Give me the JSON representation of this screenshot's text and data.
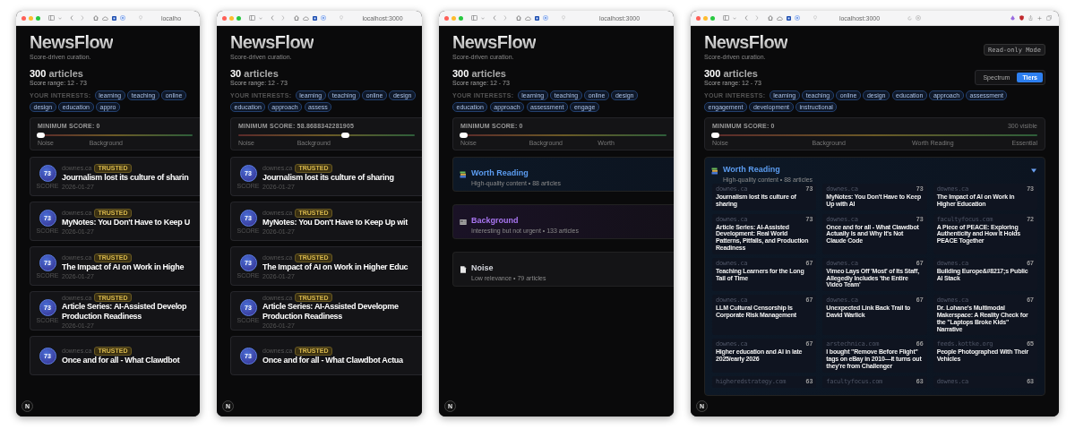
{
  "windows": [
    {
      "url": "localho",
      "toolbar_extras": false,
      "dev_badge": "N",
      "app": {
        "title": "NewsFlow",
        "tagline": "Score-driven curation.",
        "count": "300",
        "count_unit": "articles",
        "score_range": "Score range: 12 - 73",
        "interests_label": "YOUR INTERESTS:",
        "interests": [
          "learning",
          "teaching",
          "online",
          "design",
          "education",
          "appro"
        ],
        "filter": {
          "label": "MINIMUM SCORE: 0",
          "level": 0,
          "scale": [
            "Noise",
            "Background"
          ]
        },
        "view": {
          "kind": "list",
          "cards": [
            {
              "score": "73",
              "score_label": "SCORE",
              "source": "downes.ca",
              "badge": "TRUSTED",
              "title_lines": [
                "Journalism lost its culture of sharin"
              ],
              "date": "2026-01-27"
            },
            {
              "score": "73",
              "score_label": "SCORE",
              "source": "downes.ca",
              "badge": "TRUSTED",
              "title_lines": [
                "MyNotes: You Don't Have to Keep U"
              ],
              "date": "2026-01-27"
            },
            {
              "score": "73",
              "score_label": "SCORE",
              "source": "downes.ca",
              "badge": "TRUSTED",
              "title_lines": [
                "The Impact of AI on Work in Highe"
              ],
              "date": "2026-01-27"
            },
            {
              "score": "73",
              "score_label": "SCORE",
              "source": "downes.ca",
              "badge": "TRUSTED",
              "title_lines": [
                "Article Series: AI-Assisted Develop",
                "Production Readiness"
              ],
              "date": "2026-01-27"
            },
            {
              "score": "73",
              "source": "downes.ca",
              "badge": "TRUSTED",
              "title_lines": [
                "Once and for all - What Clawdbot"
              ]
            }
          ]
        }
      }
    },
    {
      "url": "localhost:3000",
      "toolbar_extras": false,
      "dev_badge": "N",
      "app": {
        "title": "NewsFlow",
        "tagline": "Score-driven curation.",
        "count": "30",
        "count_unit": "articles",
        "score_range": "Score range: 12 - 73",
        "interests_label": "YOUR INTERESTS:",
        "interests": [
          "learning",
          "teaching",
          "online",
          "design",
          "education",
          "approach",
          "assess"
        ],
        "filter": {
          "label": "MINIMUM SCORE: 58.8688342281905",
          "level": 0.59,
          "scale": [
            "Noise",
            "Background"
          ]
        },
        "view": {
          "kind": "list",
          "cards": [
            {
              "score": "73",
              "score_label": "SCORE",
              "source": "downes.ca",
              "badge": "TRUSTED",
              "title_lines": [
                "Journalism lost its culture of sharing"
              ],
              "date": "2026-01-27"
            },
            {
              "score": "73",
              "score_label": "SCORE",
              "source": "downes.ca",
              "badge": "TRUSTED",
              "title_lines": [
                "MyNotes: You Don't Have to Keep Up wit"
              ],
              "date": "2026-01-27"
            },
            {
              "score": "73",
              "score_label": "SCORE",
              "source": "downes.ca",
              "badge": "TRUSTED",
              "title_lines": [
                "The Impact of AI on Work in Higher Educ"
              ],
              "date": "2026-01-27"
            },
            {
              "score": "73",
              "score_label": "SCORE",
              "source": "downes.ca",
              "badge": "TRUSTED",
              "title_lines": [
                "Article Series: AI-Assisted Developme",
                "Production Readiness"
              ],
              "date": "2026-01-27"
            },
            {
              "score": "73",
              "source": "downes.ca",
              "badge": "TRUSTED",
              "title_lines": [
                "Once and for all - What Clawdbot Actua"
              ]
            }
          ]
        }
      }
    },
    {
      "url": "localhost:3000",
      "toolbar_extras": false,
      "dev_badge": "N",
      "app": {
        "title": "NewsFlow",
        "tagline": "Score-driven curation.",
        "count": "300",
        "count_unit": "articles",
        "score_range": "Score range: 12 - 73",
        "interests_label": "YOUR INTERESTS:",
        "interests": [
          "learning",
          "teaching",
          "online",
          "design",
          "education",
          "approach",
          "assessment",
          "engage"
        ],
        "filter": {
          "label": "MINIMUM SCORE: 0",
          "level": 0,
          "scale": [
            "Noise",
            "Background",
            "Worth"
          ]
        },
        "view": {
          "kind": "tiers",
          "tiers": [
            {
              "kind": "worth",
              "name": "Worth Reading",
              "summary": "High-quality content • 88 articles",
              "color": "#5b9cf0",
              "expanded": false
            },
            {
              "kind": "background",
              "name": "Background",
              "summary": "Interesting but not urgent • 133 articles",
              "color": "#a875f0",
              "expanded": false
            },
            {
              "kind": "noise",
              "name": "Noise",
              "summary": "Low relevance • 79 articles",
              "color": "#d4d6dc",
              "expanded": false
            }
          ]
        }
      }
    },
    {
      "url": "localhost:3000",
      "toolbar_extras": true,
      "dev_badge": "N",
      "app": {
        "title": "NewsFlow",
        "tagline": "Score-driven curation.",
        "mode_badge": "Read-only Mode",
        "count": "300",
        "count_unit": "articles",
        "score_range": "Score range: 12 - 73",
        "view_toggle": [
          {
            "label": "Spectrum",
            "selected": false
          },
          {
            "label": "Tiers",
            "selected": true
          }
        ],
        "interests_label": "YOUR INTERESTS:",
        "interests": [
          "learning",
          "teaching",
          "online",
          "design",
          "education",
          "approach",
          "assessment",
          "engagement",
          "development",
          "instructional"
        ],
        "filter": {
          "label": "MINIMUM SCORE: 0",
          "visible": "300 visible",
          "level": 0,
          "scale": [
            "Noise",
            "Background",
            "Worth Reading",
            "Essential"
          ]
        },
        "view": {
          "kind": "tiers",
          "tiers": [
            {
              "kind": "worth",
              "name": "Worth Reading",
              "summary": "High-quality content • 88 articles",
              "color": "#5b9cf0",
              "expanded": true,
              "articles": [
                {
                  "source": "downes.ca",
                  "score": "73",
                  "title": "Journalism lost its culture of sharing"
                },
                {
                  "source": "downes.ca",
                  "score": "73",
                  "title": "MyNotes: You Don't Have to Keep Up with AI"
                },
                {
                  "source": "downes.ca",
                  "score": "73",
                  "title": "The Impact of AI on Work in Higher Education"
                },
                {
                  "source": "downes.ca",
                  "score": "73",
                  "title": "Article Series: AI-Assisted Development: Real World Patterns, Pitfalls, and Production Readiness"
                },
                {
                  "source": "downes.ca",
                  "score": "73",
                  "title": "Once and for all - What Clawdbot Actually Is and Why It's Not Claude Code"
                },
                {
                  "source": "facultyfocus.com",
                  "score": "72",
                  "title": "A Piece of PEACE: Exploring Authenticity and How It Holds PEACE Together"
                },
                {
                  "source": "downes.ca",
                  "score": "67",
                  "title": "Teaching Learners for the Long Tail of Time"
                },
                {
                  "source": "downes.ca",
                  "score": "67",
                  "title": "Vimeo Lays Off 'Most' of Its Staff, Allegedly Includes 'the Entire Video Team'"
                },
                {
                  "source": "downes.ca",
                  "score": "67",
                  "title": "Building Europe&#8217;s Public AI Stack"
                },
                {
                  "source": "downes.ca",
                  "score": "67",
                  "title": "LLM Cultural Censorship Is Corporate Risk Management"
                },
                {
                  "source": "downes.ca",
                  "score": "67",
                  "title": "Unexpected Link Back Trail to David Warlick"
                },
                {
                  "source": "downes.ca",
                  "score": "67",
                  "title": "Dr. Lohane's Multimodal Makerspace: A Reality Check for the \"Laptops Broke Kids\" Narrative"
                },
                {
                  "source": "downes.ca",
                  "score": "67",
                  "title": "Higher education and AI in late 2025/early 2026"
                },
                {
                  "source": "arstechnica.com",
                  "score": "66",
                  "title": "I bought \"Remove Before Flight\" tags on eBay in 2010—it turns out they're from Challenger"
                },
                {
                  "source": "feeds.kottke.org",
                  "score": "65",
                  "title": "People Photographed With Their Vehicles"
                },
                {
                  "source": "higheredstrategy.com",
                  "score": "63"
                },
                {
                  "source": "facultyfocus.com",
                  "score": "63"
                },
                {
                  "source": "downes.ca",
                  "score": "63"
                }
              ]
            }
          ]
        }
      }
    }
  ]
}
